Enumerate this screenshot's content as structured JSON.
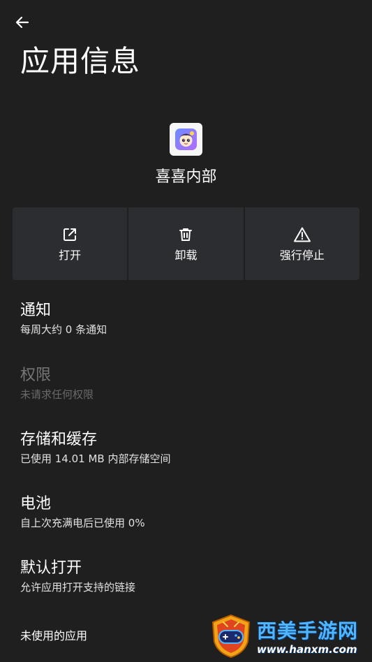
{
  "header": {
    "back_icon": "arrow-left-icon",
    "title": "应用信息"
  },
  "app": {
    "icon": "app-icon",
    "name": "喜喜内部"
  },
  "actions": [
    {
      "label": "打开",
      "icon": "open-external-icon"
    },
    {
      "label": "卸载",
      "icon": "trash-icon"
    },
    {
      "label": "强行停止",
      "icon": "warning-icon"
    }
  ],
  "settings": [
    {
      "title": "通知",
      "subtitle": "每周大约 0 条通知",
      "enabled": true
    },
    {
      "title": "权限",
      "subtitle": "未请求任何权限",
      "enabled": false
    },
    {
      "title": "存储和缓存",
      "subtitle": "已使用 14.01 MB 内部存储空间",
      "enabled": true
    },
    {
      "title": "电池",
      "subtitle": "自上次充满电后已使用 0%",
      "enabled": true
    },
    {
      "title": "默认打开",
      "subtitle": "允许应用打开支持的链接",
      "enabled": true
    },
    {
      "title": "未使用的应用",
      "enabled": true
    }
  ],
  "watermark": {
    "icon": "gamepad-badge-icon",
    "name": "西美手游网",
    "url": "www.hanxm.com"
  },
  "colors": {
    "background": "#1f1f1f",
    "action_tile": "#2c2d30",
    "disabled_text": "#767676",
    "watermark_blue": "#4fb6ff"
  }
}
